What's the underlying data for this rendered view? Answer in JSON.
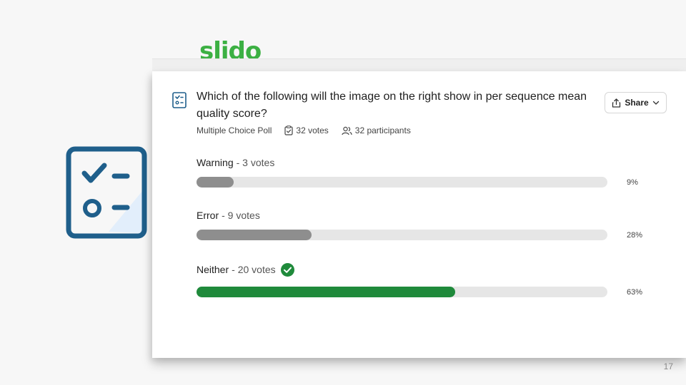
{
  "brand": {
    "logo_text": "slido",
    "color": "#3cb043"
  },
  "poll": {
    "question": "Which of the following will the image on the right show in per sequence mean quality score?",
    "type": "Multiple Choice Poll",
    "votes_text": "32 votes",
    "participants_text": "32 participants",
    "share_label": "Share",
    "options": [
      {
        "name": "Warning",
        "votes_text": "- 3 votes",
        "percent": 9,
        "percent_text": "9%",
        "correct": false
      },
      {
        "name": "Error",
        "votes_text": "- 9 votes",
        "percent": 28,
        "percent_text": "28%",
        "correct": false
      },
      {
        "name": "Neither",
        "votes_text": "- 20 votes",
        "percent": 63,
        "percent_text": "63%",
        "correct": true
      }
    ]
  },
  "colors": {
    "bar_default": "#8e8e8e",
    "bar_correct": "#1f8a3b",
    "track": "#e6e6e6",
    "icon_blue": "#1f5f8b"
  },
  "icons": {
    "big": "checklist-icon",
    "poll": "poll-icon",
    "votes": "clipboard-check-icon",
    "participants": "people-icon",
    "share": "share-icon",
    "dropdown": "chevron-down-icon",
    "correct": "check-circle-icon"
  },
  "slide": {
    "page_number": "17"
  }
}
